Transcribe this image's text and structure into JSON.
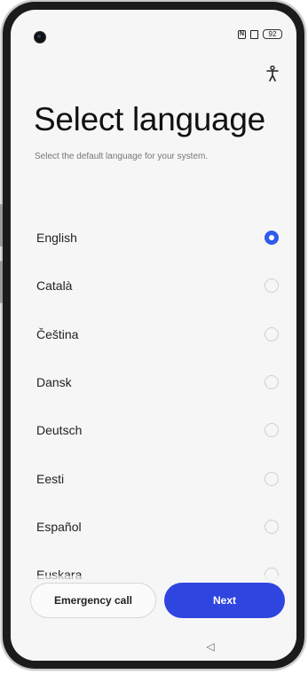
{
  "status_bar": {
    "nfc_icon": "N",
    "sim_icon": "▣",
    "battery_level": "92"
  },
  "accessibility_icon": "accessibility-icon",
  "header": {
    "title": "Select language",
    "subtitle": "Select the default language for your system."
  },
  "languages": [
    {
      "label": "English",
      "selected": true
    },
    {
      "label": "Català",
      "selected": false
    },
    {
      "label": "Čeština",
      "selected": false
    },
    {
      "label": "Dansk",
      "selected": false
    },
    {
      "label": "Deutsch",
      "selected": false
    },
    {
      "label": "Eesti",
      "selected": false
    },
    {
      "label": "Español",
      "selected": false
    },
    {
      "label": "Euskara",
      "selected": false
    }
  ],
  "footer": {
    "emergency_label": "Emergency call",
    "next_label": "Next"
  },
  "nav": {
    "back_glyph": "◁"
  },
  "colors": {
    "accent": "#2f45e0",
    "radio_selected": "#2f5bea"
  }
}
